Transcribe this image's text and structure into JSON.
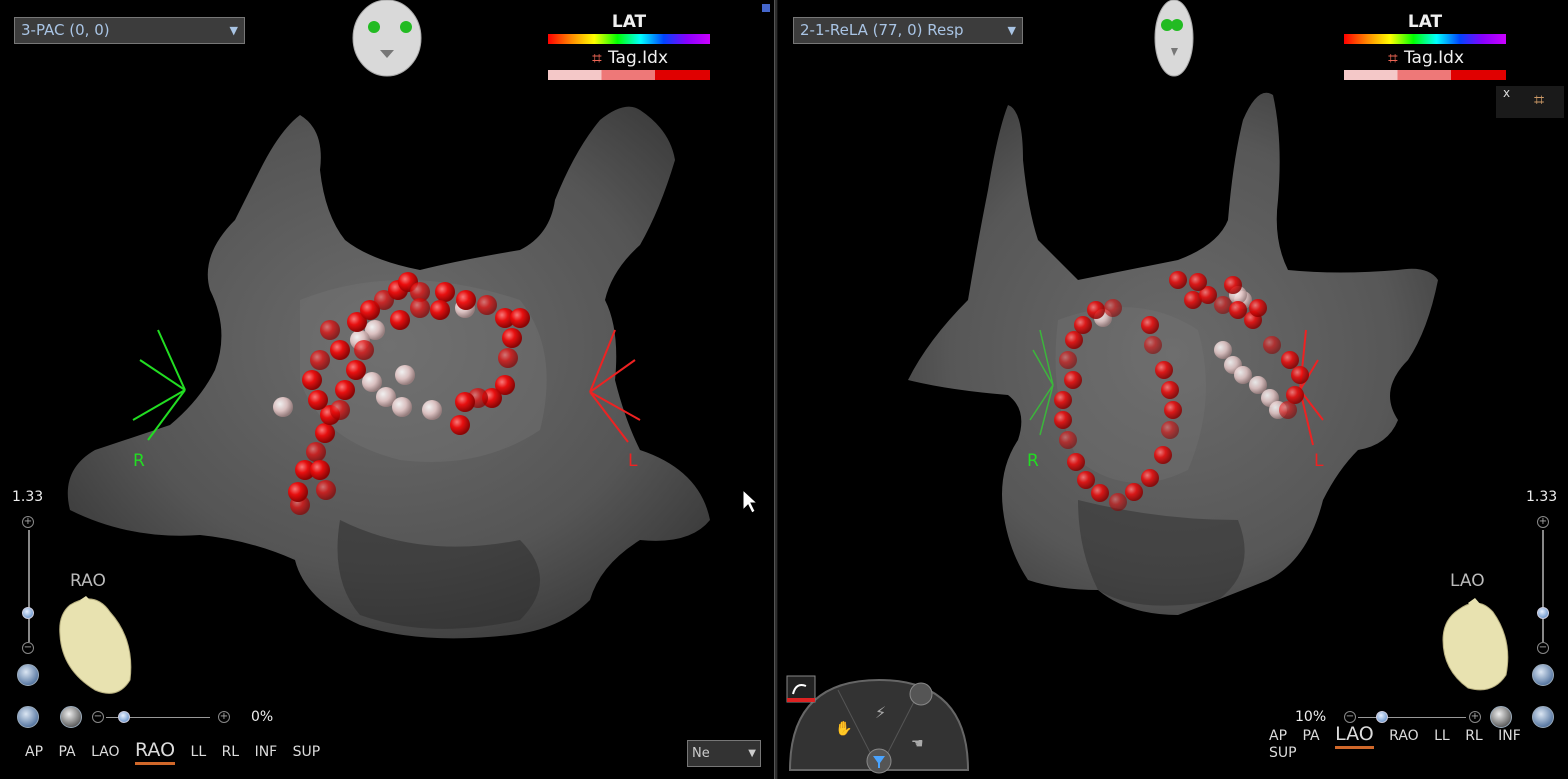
{
  "left_view": {
    "view_select": "3-PAC (0, 0)",
    "legend_title": "LAT",
    "legend_tag": "Tag.Idx",
    "zoom": "1.33",
    "orientation": "RAO",
    "opacity_pct": "0%",
    "axis_right": "R",
    "axis_left": "L",
    "view_buttons": [
      "AP",
      "PA",
      "LAO",
      "RAO",
      "LL",
      "RL",
      "INF",
      "SUP"
    ],
    "active_view": "RAO",
    "mini_select": "Ne"
  },
  "right_view": {
    "view_select": "2-1-ReLA (77, 0) Resp",
    "legend_title": "LAT",
    "legend_tag": "Tag.Idx",
    "zoom": "1.33",
    "orientation": "LAO",
    "opacity_pct": "10%",
    "axis_right": "R",
    "axis_left": "L",
    "view_buttons": [
      "AP",
      "PA",
      "LAO",
      "RAO",
      "LL",
      "RL",
      "INF",
      "SUP"
    ],
    "active_view": "LAO",
    "close_glyph": "x"
  },
  "colors": {
    "accent_orange": "#d0682a",
    "axis_green": "#22dd22",
    "axis_red": "#ee2222",
    "tag_red": "#e00000",
    "select_text": "#a9c4e4"
  }
}
